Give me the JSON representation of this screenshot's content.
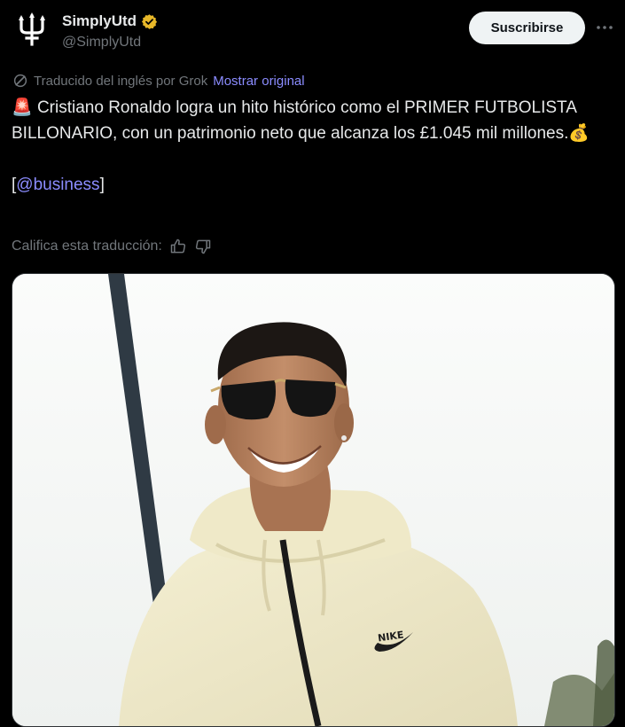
{
  "author": {
    "display_name": "SimplyUtd",
    "handle": "@SimplyUtd",
    "verified_icon": "verified-badge-icon",
    "avatar_icon": "trident-logo-icon"
  },
  "actions": {
    "subscribe_label": "Suscribirse",
    "more_icon": "more-options-icon"
  },
  "translation": {
    "note": "Traducido del inglés por Grok",
    "show_original": "Mostrar original"
  },
  "post": {
    "emoji_siren": "🚨",
    "text_line": " Cristiano Ronaldo logra un hito histórico como el PRIMER FUTBOLISTA BILLONARIO, con un patrimonio neto que alcanza los £1.045 mil millones.",
    "emoji_money": "💰",
    "bracket_open": "[",
    "mention": "@business",
    "bracket_close": "]"
  },
  "rating": {
    "label": "Califica esta traducción:",
    "thumbs_up_icon": "thumbs-up-icon",
    "thumbs_down_icon": "thumbs-down-icon"
  },
  "colors": {
    "background": "#000000",
    "text": "#e7e9ea",
    "muted": "#71767b",
    "link": "#8b8cff",
    "verified": "#e8b829"
  }
}
